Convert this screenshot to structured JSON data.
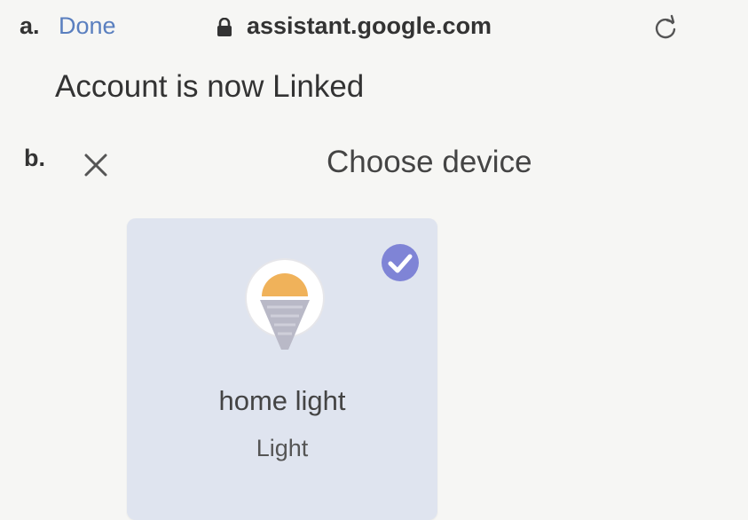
{
  "section_a": {
    "marker": "a.",
    "done_label": "Done",
    "url": "assistant.google.com",
    "message": "Account is now Linked"
  },
  "section_b": {
    "marker": "b.",
    "title": "Choose device",
    "device": {
      "name": "home light",
      "type": "Light",
      "selected": true
    }
  },
  "colors": {
    "link": "#5a7fbf",
    "card_bg": "#dfe4ef",
    "check": "#7f84d6",
    "bulb_top": "#f0b25a",
    "bulb_body": "#b9b9c7"
  },
  "icons": [
    "lock-icon",
    "reload-icon",
    "close-icon",
    "lightbulb-icon",
    "check-circle-icon"
  ]
}
